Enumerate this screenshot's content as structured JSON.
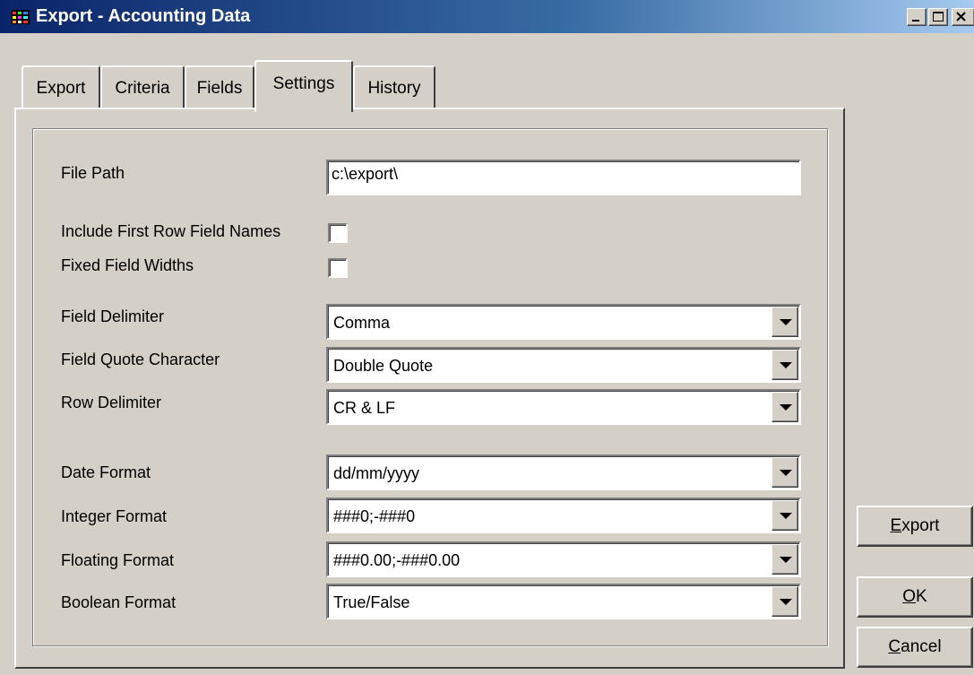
{
  "window": {
    "title": "Export - Accounting Data",
    "icon": "app-icon",
    "controls": [
      "minimize-icon",
      "maximize-icon",
      "close-icon"
    ]
  },
  "tabs": [
    {
      "label": "Export",
      "active": false
    },
    {
      "label": "Criteria",
      "active": false
    },
    {
      "label": "Fields",
      "active": false
    },
    {
      "label": "Settings",
      "active": true
    },
    {
      "label": "History",
      "active": false
    }
  ],
  "settings": {
    "file_path": {
      "label": "File Path",
      "value": "c:\\export\\"
    },
    "include_first_row": {
      "label": "Include First Row Field Names",
      "checked": false
    },
    "fixed_widths": {
      "label": "Fixed Field Widths",
      "checked": false
    },
    "field_delimiter": {
      "label": "Field Delimiter",
      "value": "Comma"
    },
    "field_quote": {
      "label": "Field Quote Character",
      "value": "Double Quote"
    },
    "row_delimiter": {
      "label": "Row Delimiter",
      "value": "CR & LF"
    },
    "date_format": {
      "label": "Date Format",
      "value": "dd/mm/yyyy"
    },
    "integer_format": {
      "label": "Integer Format",
      "value": "###0;-###0"
    },
    "floating_format": {
      "label": "Floating Format",
      "value": "###0.00;-###0.00"
    },
    "boolean_format": {
      "label": "Boolean Format",
      "value": "True/False"
    }
  },
  "buttons": {
    "export": {
      "mnemonic": "E",
      "rest": "xport"
    },
    "ok": {
      "mnemonic": "O",
      "rest": "K"
    },
    "cancel": {
      "mnemonic": "C",
      "rest": "ancel"
    }
  },
  "colors": {
    "face": "#d4d0c8",
    "title_gradient_start": "#0a246a",
    "title_gradient_end": "#a6caf0"
  }
}
